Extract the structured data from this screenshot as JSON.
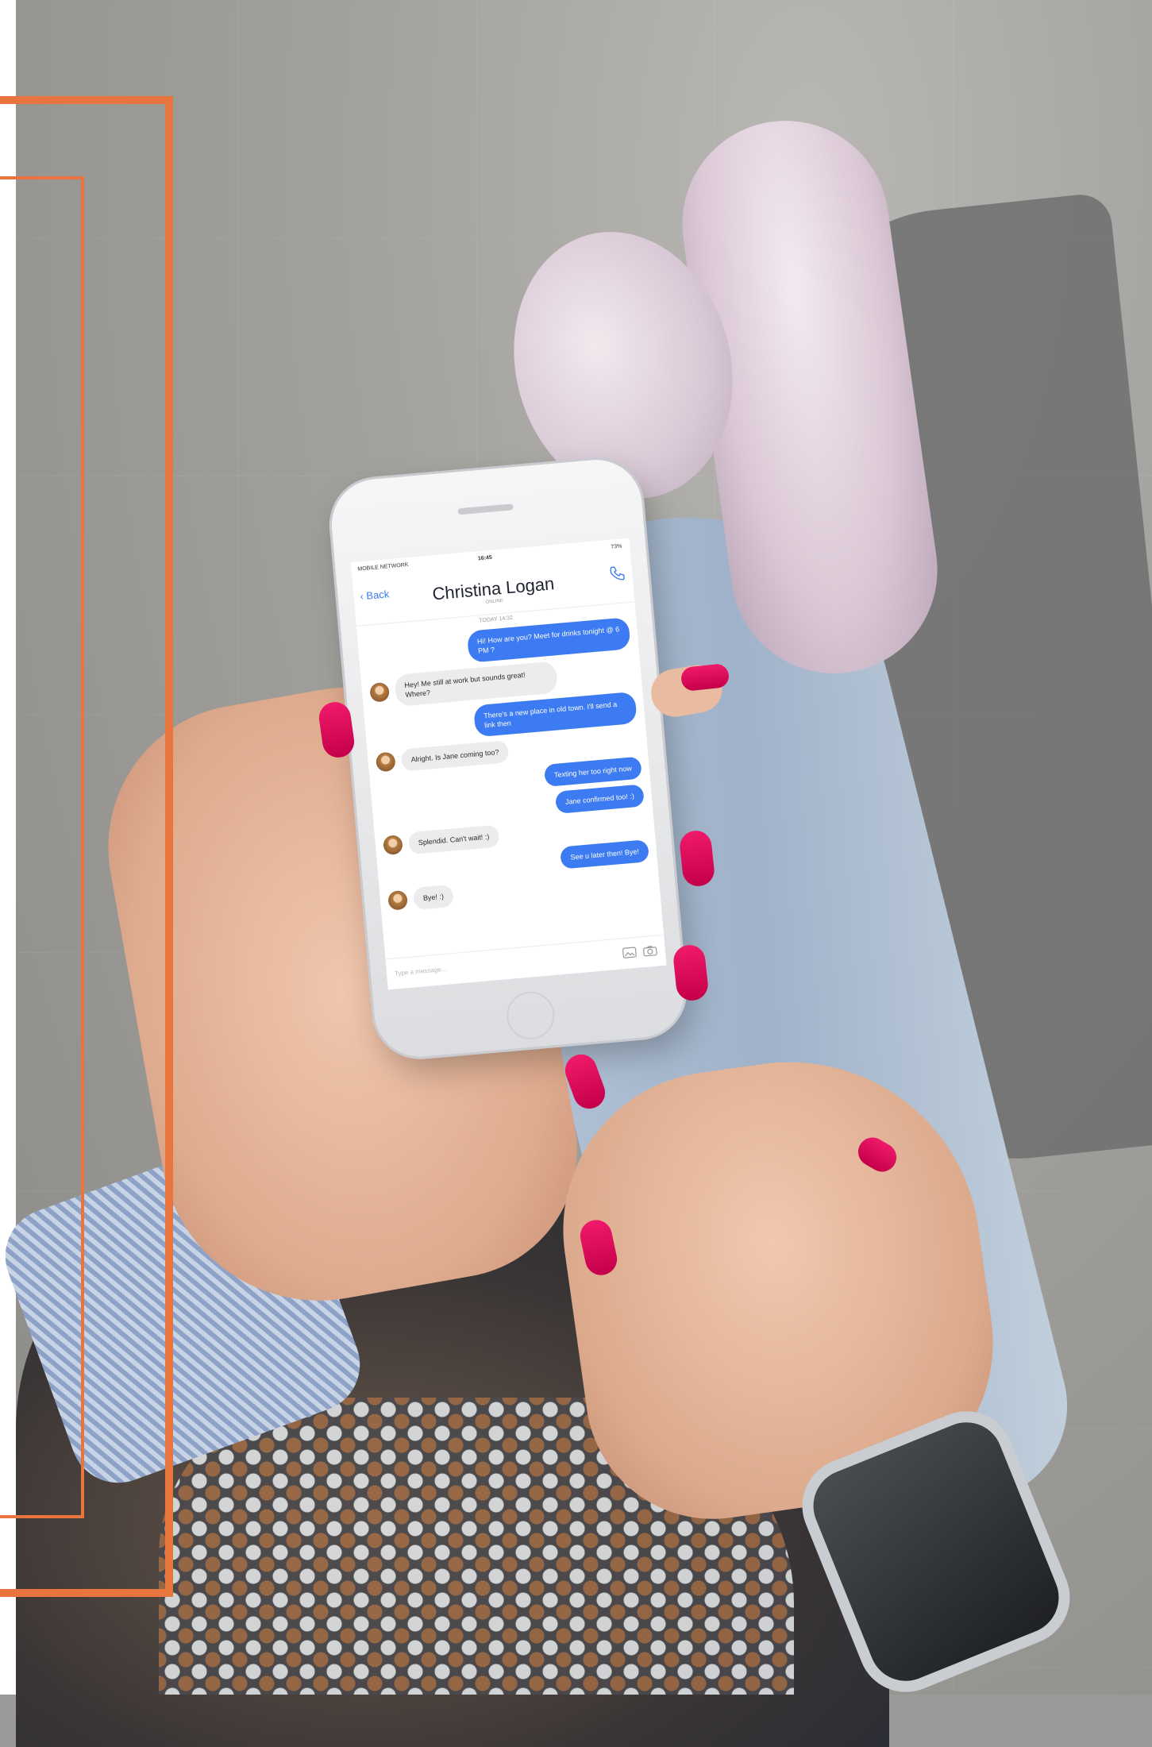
{
  "phone": {
    "statusbar": {
      "carrier": "MOBILE NETWORK",
      "time": "16:45",
      "battery": "73%"
    },
    "header": {
      "back": "‹ Back",
      "name": "Christina Logan",
      "status": "ONLINE"
    },
    "thread": {
      "day": "TODAY 14:32",
      "messages": [
        {
          "dir": "out",
          "text": "Hi! How are you? Meet for drinks tonight @ 6 PM ?"
        },
        {
          "dir": "in",
          "text": "Hey! Me still at work but sounds great! Where?"
        },
        {
          "dir": "out",
          "text": "There's a new place in old town. I'll send a link then"
        },
        {
          "dir": "in",
          "text": "Alright. Is Jane coming too?"
        },
        {
          "dir": "out",
          "text": "Texting her too right now"
        },
        {
          "dir": "out",
          "text": "Jane confirmed too! :)"
        },
        {
          "dir": "in",
          "text": "Splendid. Can't wait! :)"
        },
        {
          "dir": "out",
          "text": "See u later then! Bye!"
        },
        {
          "dir": "in",
          "text": "Bye! :)"
        }
      ]
    },
    "composer": {
      "placeholder": "Type a message..."
    },
    "icons": {
      "call": "phone-call-icon",
      "image": "image-icon",
      "camera": "camera-icon"
    },
    "colors": {
      "outgoing": "#3d7bf2",
      "incoming": "#ececee",
      "frame": "#e8753d",
      "nails": "#e5125c"
    }
  }
}
